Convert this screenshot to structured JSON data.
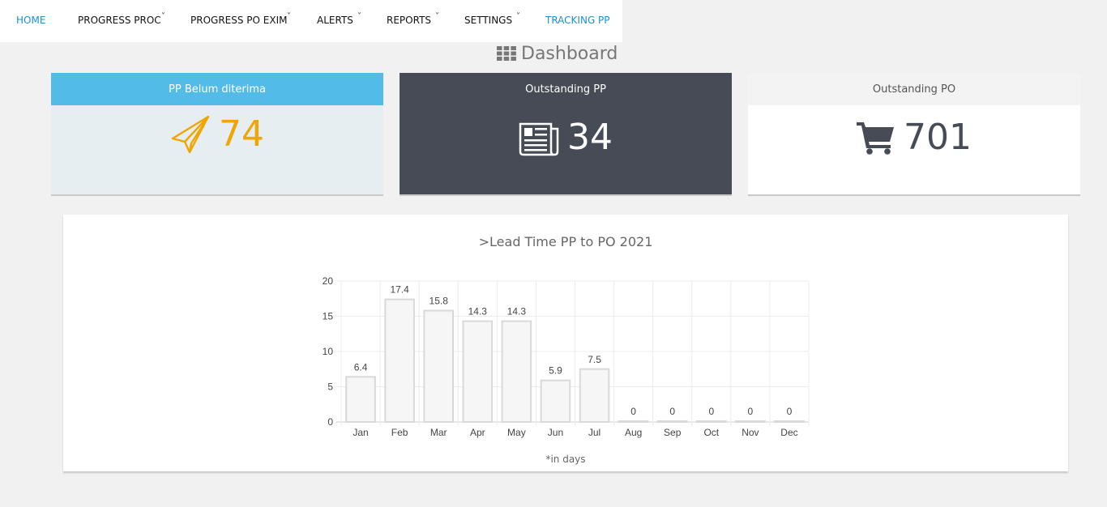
{
  "nav": {
    "items": [
      {
        "label": "HOME",
        "dropdown": false,
        "active": true
      },
      {
        "label": "PROGRESS PROC",
        "dropdown": true,
        "active": false
      },
      {
        "label": "PROGRESS PO EXIM",
        "dropdown": true,
        "active": false
      },
      {
        "label": "ALERTS",
        "dropdown": true,
        "active": false
      },
      {
        "label": "REPORTS",
        "dropdown": true,
        "active": false
      },
      {
        "label": "SETTINGS",
        "dropdown": true,
        "active": false
      },
      {
        "label": "TRACKING PP",
        "dropdown": false,
        "active": true
      }
    ]
  },
  "page": {
    "title": "Dashboard",
    "title_icon": "grid-icon"
  },
  "cards": [
    {
      "title": "PP Belum diterima",
      "value": "74",
      "icon": "paper-plane-icon",
      "color": "#f0a500"
    },
    {
      "title": "Outstanding PP",
      "value": "34",
      "icon": "newspaper-icon",
      "color": "#ffffff"
    },
    {
      "title": "Outstanding PO",
      "value": "701",
      "icon": "shopping-cart-icon",
      "color": "#464b55"
    }
  ],
  "chart": {
    "note": "*in days"
  },
  "colors": {
    "accent_blue": "#53bbe7",
    "dark_card": "#464b55",
    "nav_active": "#1a8fd6",
    "plane_orange": "#f0a500"
  },
  "chart_data": {
    "type": "bar",
    "title": ">Lead Time PP to PO 2021",
    "categories": [
      "Jan",
      "Feb",
      "Mar",
      "Apr",
      "May",
      "Jun",
      "Jul",
      "Aug",
      "Sep",
      "Oct",
      "Nov",
      "Dec"
    ],
    "values": [
      6.4,
      17.4,
      15.8,
      14.3,
      14.3,
      5.9,
      7.5,
      0,
      0,
      0,
      0,
      0
    ],
    "data_labels": [
      "6.4",
      "17.4",
      "15.8",
      "14.3",
      "14.3",
      "5.9",
      "7.5",
      "0",
      "0",
      "0",
      "0",
      "0"
    ],
    "ylim": [
      0,
      20
    ],
    "yticks": [
      0,
      5,
      10,
      15,
      20
    ],
    "xlabel": "",
    "ylabel": "",
    "grid": true,
    "legend": false
  }
}
